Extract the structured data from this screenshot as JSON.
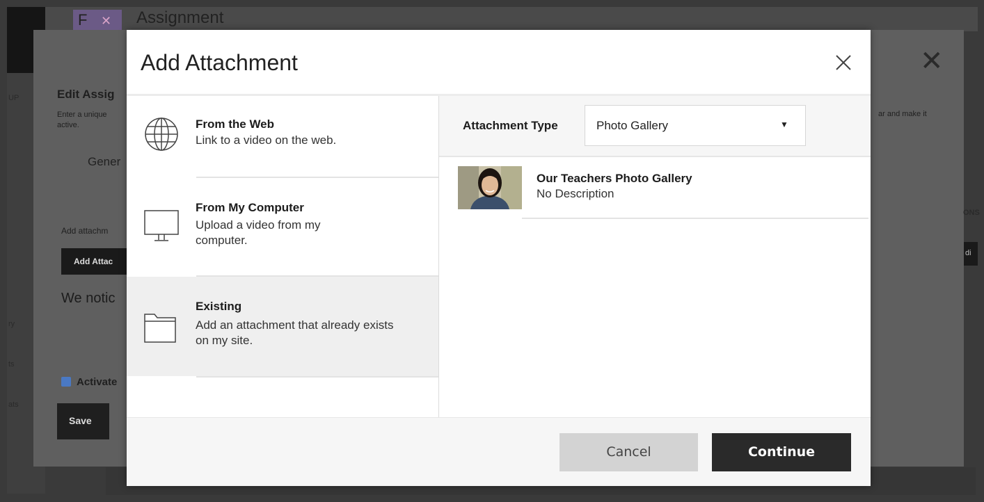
{
  "background": {
    "page_title": "Assignment",
    "logo_text": "F",
    "edit_title": "Edit Assig",
    "edit_subtitle": "Enter a unique active.",
    "right_subtitle": "ar and make it",
    "general_tab": "Gener",
    "add_attachment_label": "Add attachm",
    "add_attachment_button": "Add Attac",
    "notice_text": "We notic",
    "activate_label": "Activate",
    "save_button": "Save",
    "side_labels": [
      "UP",
      "ry",
      "ts",
      "ats",
      "ONS",
      "di"
    ],
    "close_glyph": "✕"
  },
  "modal": {
    "title": "Add Attachment",
    "options": [
      {
        "title": "From the Web",
        "description": "Link to a video on the web.",
        "icon": "globe-icon",
        "selected": false
      },
      {
        "title": "From My Computer",
        "description": "Upload a video from my computer.",
        "icon": "monitor-icon",
        "selected": false
      },
      {
        "title": "Existing",
        "description": "Add an attachment that already exists on my site.",
        "icon": "folder-icon",
        "selected": true
      }
    ],
    "attachment_type": {
      "label": "Attachment Type",
      "selected": "Photo Gallery",
      "arrow": "▼"
    },
    "items": [
      {
        "title": "Our Teachers Photo Gallery",
        "description": "No Description",
        "thumbnail": "person-photo"
      }
    ],
    "footer": {
      "cancel_label": "Cancel",
      "continue_label": "Continue"
    }
  },
  "colors": {
    "overlay": "#3a3a3a",
    "selected_option_bg": "#efefef",
    "continue_bg": "#2a2a2a",
    "cancel_bg": "#d3d3d3"
  }
}
